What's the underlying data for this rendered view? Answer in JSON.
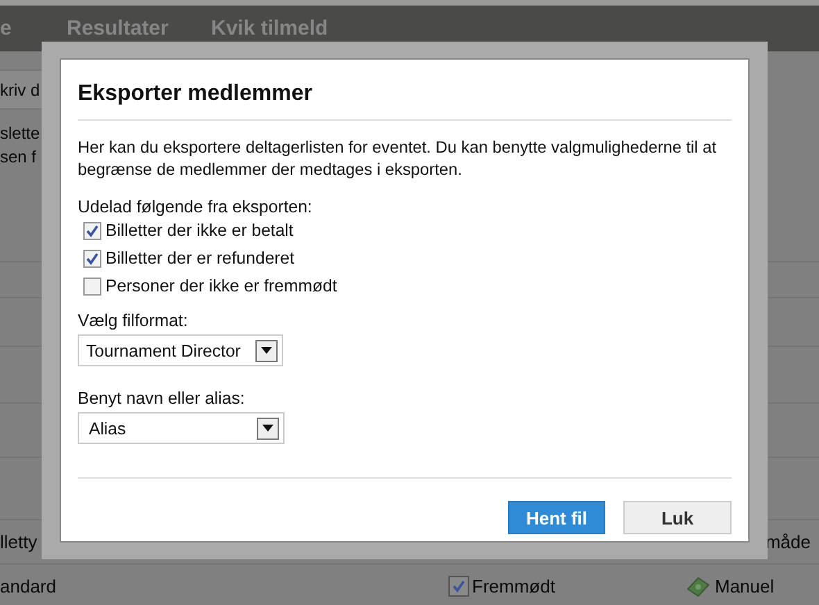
{
  "navigation": {
    "items": [
      {
        "label": "e"
      },
      {
        "label": "Resultater"
      },
      {
        "label": "Kvik tilmeld"
      }
    ]
  },
  "background": {
    "search_field": {
      "value": "kriv d"
    },
    "text_lines": [
      "slette",
      "sen f"
    ],
    "column_1_heading": "lletty",
    "column_2_heading": "måde",
    "row": {
      "ticket_type": "andard",
      "attended": {
        "label": "Fremmødt",
        "checked": true
      },
      "payment": "Manuel"
    }
  },
  "dialog": {
    "title": "Eksporter medlemmer",
    "description": "Her kan du eksportere deltagerlisten for eventet. Du kan benytte valgmulighederne til at begrænse de medlemmer der medtages i eksporten.",
    "exclude_label": "Udelad følgende fra eksporten:",
    "exclude_options": [
      {
        "label": "Billetter der ikke er betalt",
        "checked": true
      },
      {
        "label": "Billetter der er refunderet",
        "checked": true
      },
      {
        "label": "Personer der ikke er fremmødt",
        "checked": false
      }
    ],
    "format": {
      "label": "Vælg filformat:",
      "value": "Tournament Director"
    },
    "name_choice": {
      "label": "Benyt navn eller alias:",
      "value": "Alias"
    },
    "buttons": [
      {
        "label": "Hent fil",
        "kind": "primary"
      },
      {
        "label": "Luk",
        "kind": "secondary"
      }
    ]
  }
}
